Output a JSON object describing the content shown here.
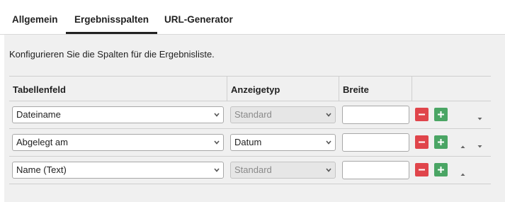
{
  "tabs": [
    {
      "label": "Allgemein",
      "active": false
    },
    {
      "label": "Ergebnisspalten",
      "active": true
    },
    {
      "label": "URL-Generator",
      "active": false
    }
  ],
  "intro": "Konfigurieren Sie die Spalten für die Ergebnisliste.",
  "table": {
    "headers": [
      "Tabellenfeld",
      "Anzeigetyp",
      "Breite"
    ],
    "rows": [
      {
        "field": "Dateiname",
        "type": "Standard",
        "type_disabled": true,
        "width": "",
        "up": false,
        "down": true
      },
      {
        "field": "Abgelegt am",
        "type": "Datum",
        "type_disabled": false,
        "width": "",
        "up": true,
        "down": true
      },
      {
        "field": "Name (Text)",
        "type": "Standard",
        "type_disabled": true,
        "width": "",
        "up": true,
        "down": false
      }
    ]
  },
  "colors": {
    "remove": "#e0454b",
    "add": "#4aa564"
  }
}
